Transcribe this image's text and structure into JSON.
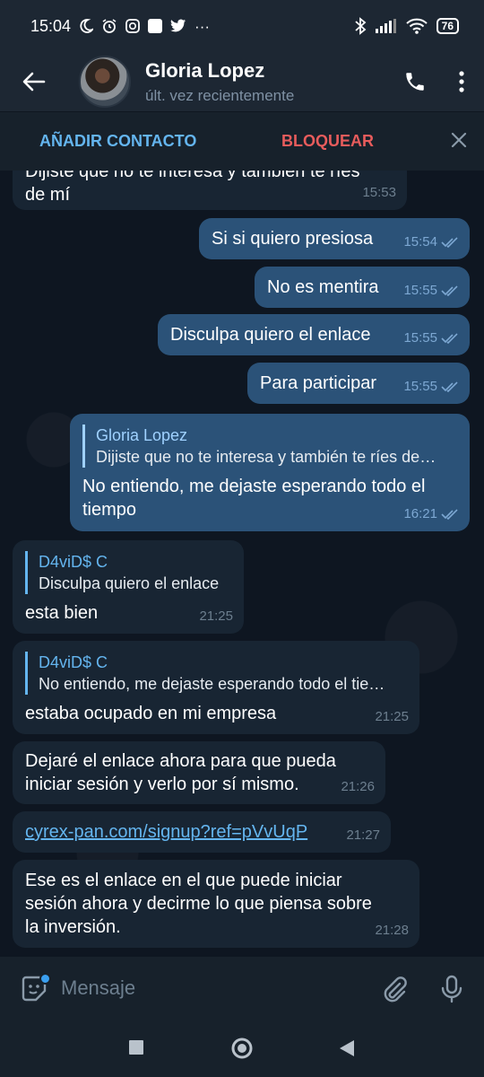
{
  "status_bar": {
    "time": "15:04",
    "battery": "76"
  },
  "header": {
    "name": "Gloria Lopez",
    "last_seen": "últ. vez recientemente"
  },
  "actions": {
    "add_contact": "AÑADIR CONTACTO",
    "block": "BLOQUEAR"
  },
  "messages": [
    {
      "dir": "in",
      "text_line1": "Dijiste que no te interesa y también te ríes",
      "text_line2": "de mí",
      "time": "15:53"
    },
    {
      "dir": "out",
      "text": "Si si quiero presiosa",
      "time": "15:54"
    },
    {
      "dir": "out",
      "text": "No es mentira",
      "time": "15:55"
    },
    {
      "dir": "out",
      "text": "Disculpa quiero el enlace",
      "time": "15:55"
    },
    {
      "dir": "out",
      "text": "Para participar",
      "time": "15:55"
    },
    {
      "dir": "out",
      "reply_name": "Gloria Lopez",
      "reply_text": "Dijiste que no te interesa y también te ríes de…",
      "text_line1": "No entiendo, me dejaste esperando todo el",
      "text_line2": "tiempo",
      "time": "16:21"
    },
    {
      "dir": "in",
      "reply_name": "D4viD$ C",
      "reply_text": "Disculpa quiero el enlace",
      "text": "esta bien",
      "time": "21:25"
    },
    {
      "dir": "in",
      "reply_name": "D4viD$ C",
      "reply_text": "No entiendo, me dejaste esperando todo el tie…",
      "text": "estaba ocupado en mi empresa",
      "time": "21:25"
    },
    {
      "dir": "in",
      "text_line1": "Dejaré el enlace ahora para que pueda",
      "text_line2": "iniciar sesión y verlo por sí mismo.",
      "time": "21:26"
    },
    {
      "dir": "in",
      "link": "cyrex-pan.com/signup?ref=pVvUqP",
      "time": "21:27"
    },
    {
      "dir": "in",
      "text_line1": "Ese es el enlace en el que puede iniciar",
      "text_line2": "sesión ahora y decirme lo que piensa sobre",
      "text_line3": "la inversión.",
      "time": "21:28"
    }
  ],
  "input": {
    "placeholder": "Mensaje"
  },
  "colors": {
    "background": "#0e1621",
    "header": "#1d2733",
    "incoming_bubble": "#182533",
    "outgoing_bubble": "#2b5278",
    "accent": "#64b5ef",
    "danger": "#e85c5c"
  },
  "icons": [
    "moon-icon",
    "alarm-icon",
    "instagram-icon",
    "twitter-icon",
    "bluetooth-icon",
    "signal-icon",
    "wifi-icon",
    "back-arrow-icon",
    "phone-icon",
    "more-icon",
    "close-icon",
    "double-check-icon",
    "sticker-icon",
    "attach-icon",
    "mic-icon"
  ]
}
